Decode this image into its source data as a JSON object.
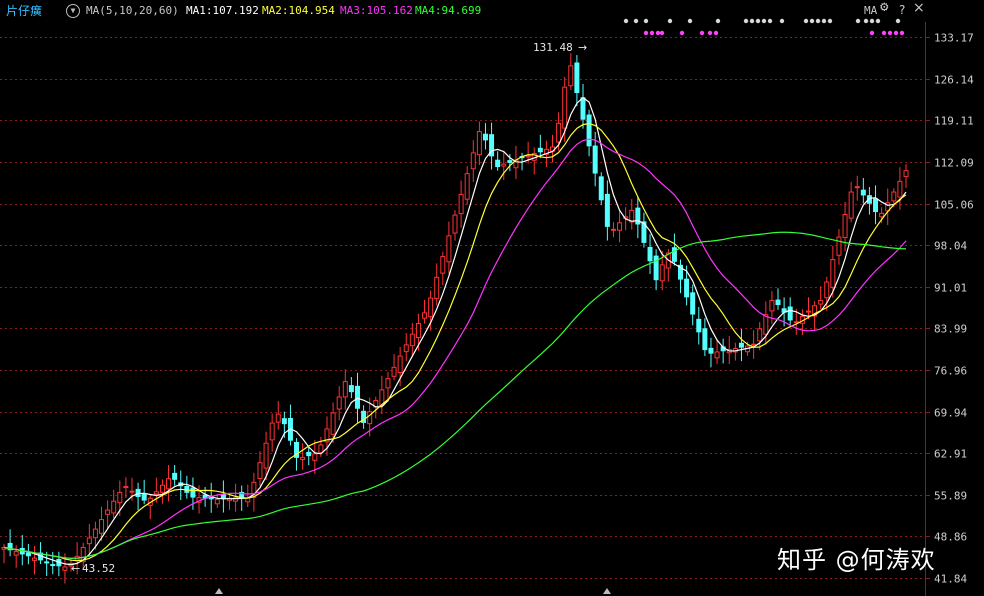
{
  "header": {
    "title": "片仔癀",
    "dropdown_icon": "chevron-down-icon",
    "ma_name": "MA(5,10,20,60)",
    "ma1": "MA1:107.192",
    "ma2": "MA2:104.954",
    "ma3": "MA3:105.162",
    "ma4": "MA4:94.699"
  },
  "toolbar": {
    "ma_label": "MA",
    "gear_icon": "gear-icon",
    "help_label": "?",
    "close_label": "×"
  },
  "watermark": "知乎 @何涛欢",
  "colors": {
    "background": "#000000",
    "up": "#ff3232",
    "down": "#54ffff",
    "ma1": "#ffffff",
    "ma2": "#ffff33",
    "ma3": "#ff33ff",
    "ma4": "#33ff33",
    "grid": "#8b1a1a"
  },
  "chart_data": {
    "type": "candlestick",
    "y_axis_ticks": [
      "133.17",
      "126.14",
      "119.11",
      "112.09",
      "105.06",
      "98.04",
      "91.01",
      "83.99",
      "76.96",
      "69.94",
      "62.91",
      "55.89",
      "48.86",
      "41.84"
    ],
    "ylim": [
      41.84,
      133.17
    ],
    "high_marker": "131.48",
    "low_marker": "43.52",
    "grid": true,
    "series": [
      {
        "name": "MA1",
        "period": 5
      },
      {
        "name": "MA2",
        "period": 10
      },
      {
        "name": "MA3",
        "period": 20
      },
      {
        "name": "MA4",
        "period": 60
      }
    ],
    "closes": [
      47.0,
      46.6,
      46.3,
      45.9,
      45.6,
      45.2,
      44.9,
      44.5,
      44.1,
      43.9,
      43.7,
      44.3,
      45.5,
      47.0,
      48.6,
      50.1,
      51.7,
      53.3,
      54.8,
      56.3,
      57.3,
      56.5,
      55.6,
      55.0,
      55.3,
      56.4,
      57.5,
      58.6,
      58.5,
      57.4,
      56.3,
      55.5,
      55.4,
      55.3,
      55.2,
      55.1,
      55.2,
      55.3,
      55.4,
      55.4,
      55.4,
      58.0,
      61.3,
      64.6,
      68.0,
      69.5,
      67.9,
      65.1,
      62.2,
      62.2,
      62.5,
      62.8,
      64.3,
      67.0,
      69.7,
      72.4,
      75.0,
      73.3,
      70.5,
      68.1,
      69.9,
      71.8,
      73.6,
      75.5,
      77.4,
      79.3,
      81.2,
      83.0,
      84.8,
      86.6,
      89.1,
      92.6,
      96.1,
      99.6,
      103.1,
      106.6,
      110.1,
      113.6,
      117.2,
      115.8,
      113.1,
      111.3,
      111.7,
      112.0,
      112.4,
      112.8,
      113.1,
      113.5,
      113.8,
      114.2,
      114.6,
      118.6,
      124.7,
      128.3,
      123.8,
      119.3,
      114.8,
      110.2,
      105.7,
      101.2,
      100.7,
      101.8,
      102.8,
      103.9,
      101.6,
      98.5,
      95.4,
      92.2,
      94.7,
      96.7,
      95.3,
      92.3,
      89.3,
      86.4,
      83.4,
      80.4,
      79.8,
      80.0,
      80.2,
      80.4,
      80.6,
      80.8,
      81.0,
      81.3,
      83.9,
      86.3,
      88.7,
      88.0,
      86.7,
      85.4,
      85.1,
      86.0,
      86.9,
      87.8,
      88.7,
      91.8,
      95.6,
      99.4,
      103.2,
      107.0,
      107.9,
      106.5,
      105.1,
      103.7,
      103.4,
      105.2,
      107.0,
      108.8,
      110.6
    ]
  }
}
